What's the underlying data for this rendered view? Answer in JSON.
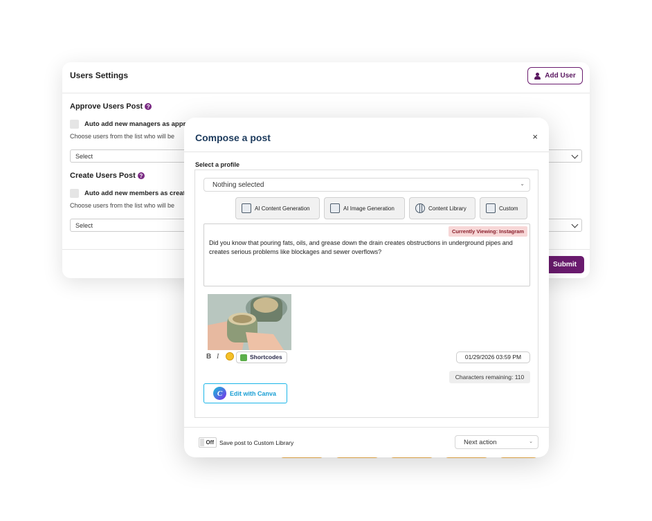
{
  "settings": {
    "title": "Users Settings",
    "add_user_label": "Add User",
    "approve": {
      "title": "Approve Users Post",
      "checkbox_label": "Auto add new managers as appro",
      "hint": "Choose users from the list who will be",
      "select_placeholder": "Select"
    },
    "create": {
      "title": "Create Users Post",
      "checkbox_label": "Auto add new members as creat",
      "hint": "Choose users from the list who will be",
      "select_placeholder": "Select"
    },
    "submit_label": "Submit"
  },
  "compose": {
    "title": "Compose a post",
    "close_glyph": "×",
    "profile_label": "Select a profile",
    "profile_value": "Nothing selected",
    "tools": [
      {
        "label": "AI Content Generation",
        "icon": "ai-content-icon"
      },
      {
        "label": "AI Image Generation",
        "icon": "ai-image-icon"
      },
      {
        "label": "Content Library",
        "icon": "globe-icon"
      },
      {
        "label": "Custom",
        "icon": "folder-icon"
      }
    ],
    "viewing_badge": "Currently Viewing: Instagram",
    "post_text": "Did you know that pouring fats, oils, and grease down the drain creates obstructions in underground pipes and creates serious problems like blockages and sewer overflows?",
    "format": {
      "bold": "B",
      "italic": "I"
    },
    "shortcodes_label": "Shortcodes",
    "datetime": "01/29/2026 03:59 PM",
    "chars_remaining": "Characters remaining:  110",
    "canva_label": "Edit with Canva",
    "canva_glyph": "C",
    "toggle_label": "Off",
    "save_label": "Save post to Custom Library",
    "next_action": "Next action"
  },
  "colors": {
    "brand_purple": "#6a1b6e",
    "title_navy": "#1c3a5c",
    "canva_blue": "#1ab5e8",
    "badge_bg": "#f7d7d7"
  }
}
